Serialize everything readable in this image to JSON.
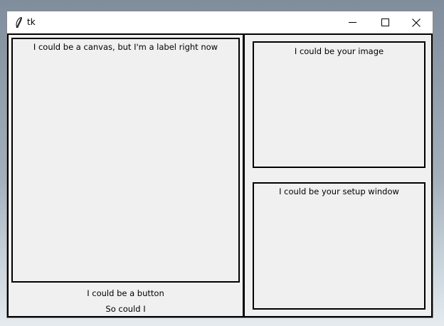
{
  "window": {
    "title": "tk",
    "title_icon": "tk-feather-icon"
  },
  "controls": {
    "minimize_icon": "minimize-icon",
    "maximize_icon": "maximize-icon",
    "close_icon": "close-icon"
  },
  "left_panel": {
    "canvas_label": "I could be a canvas, but I'm a label right now",
    "button_label": "I could be a button",
    "second_label": "So could I"
  },
  "right_panel": {
    "image_label": "I could be your image",
    "setup_label": "I could be your setup window"
  }
}
